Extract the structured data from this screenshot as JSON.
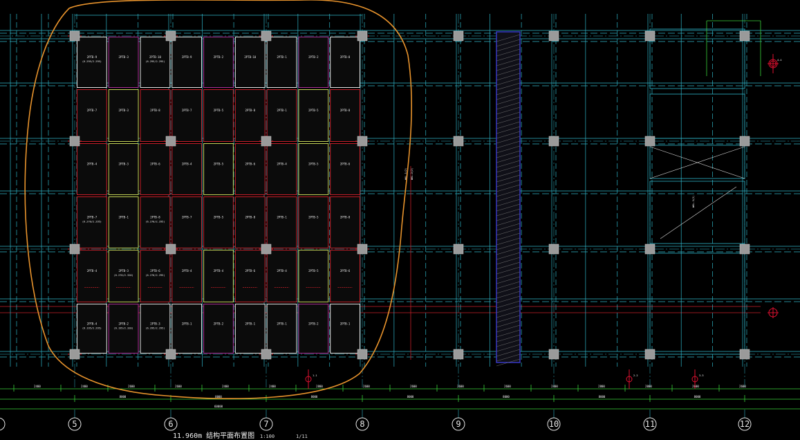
{
  "drawing": {
    "title": "11.960m 结构平面布置图",
    "scale": "1:100",
    "title_extra": "1/11",
    "background": "#000000",
    "colors": {
      "grid": "#2fb5c8",
      "beam": "#2fb5c8",
      "column": "#9a9a9a",
      "slab_red": "#c8202a",
      "slab_green": "#c7d65a",
      "slab_white": "#e6e6e6",
      "slab_magenta": "#b0309a",
      "markup_cloud": "#e8932c",
      "stair_hatch": "#3a3ad0",
      "dimension": "#3ad23a",
      "section_mark": "#e01030"
    },
    "axes": [
      "5",
      "6",
      "7",
      "8",
      "9",
      "10",
      "11",
      "12"
    ],
    "overall_dim": "60000",
    "bay_dims": [
      "8000",
      "8000",
      "8000",
      "8000",
      "8000",
      "8000",
      "8000"
    ],
    "sub_dims": [
      "2400",
      "2400",
      "2600",
      "2600",
      "2400",
      "2400",
      "2800",
      "2600",
      "2600",
      "2600",
      "2600",
      "2400",
      "2800",
      "2000",
      "2600",
      "2600"
    ],
    "slab_rows": [
      [
        "2PTB-9",
        "2PTB-3",
        "2PTB-10",
        "2PTB-9",
        "2PTB-2",
        "2PTB-10",
        "2PTB-1",
        "2PTB-2",
        "2PTB-8"
      ],
      [
        "2PTB-7",
        "2PTB-3",
        "2PTB-8",
        "2PTB-7",
        "2PTB-5",
        "2PTB-8",
        "2PTB-1",
        "2PTB-5",
        "2PTB-8"
      ],
      [
        "2PTB-4",
        "2PTB-3",
        "2PTB-6",
        "2PTB-4",
        "2PTB-5",
        "2PTB-6",
        "2PTB-4",
        "2PTB-5",
        "2PTB-6"
      ],
      [
        "2PTB-7",
        "2PTB-1",
        "2PTB-8",
        "2PTB-7",
        "2PTB-5",
        "2PTB-8",
        "2PTB-1",
        "2PTB-5",
        "2PTB-8"
      ],
      [
        "2PTB-4",
        "2PTB-3",
        "2PTB-6",
        "2PTB-4",
        "2PTB-4",
        "2PTB-6",
        "2PTB-4",
        "2PTB-5",
        "2PTB-6"
      ],
      [
        "2PTB-4",
        "2PTB-2",
        "2PTB-3",
        "2PTB-1",
        "2PTB-2",
        "2PTB-1",
        "2PTB-1",
        "2PTB-2",
        "2PTB-1"
      ]
    ],
    "slab_subs": [
      [
        "(6.295/2.295)",
        "",
        "(6.295/2.295)",
        "",
        "",
        "",
        "",
        "",
        ""
      ],
      [
        "",
        "",
        "",
        "",
        "",
        "",
        "",
        "",
        ""
      ],
      [
        "",
        "",
        "",
        "",
        "",
        "",
        "",
        "",
        ""
      ],
      [
        "(6.270/2.295)",
        "",
        "(6.270/2.295)",
        "",
        "",
        "",
        "",
        "",
        ""
      ],
      [
        "",
        "(6.270/2.320)",
        "(6.270/2.295)",
        "",
        "",
        "",
        "",
        "",
        ""
      ],
      [
        "(6.195/2.295)",
        "(6.195/2.320)",
        "(6.295/2.295)",
        "",
        "",
        "",
        "",
        "",
        ""
      ]
    ],
    "beam_tags": [
      "WKL-1(2)",
      "WKL-2(2)",
      "WKL-3(2)"
    ],
    "section_tags": [
      "1-1",
      "2-2",
      "3-3",
      "4-4"
    ]
  }
}
